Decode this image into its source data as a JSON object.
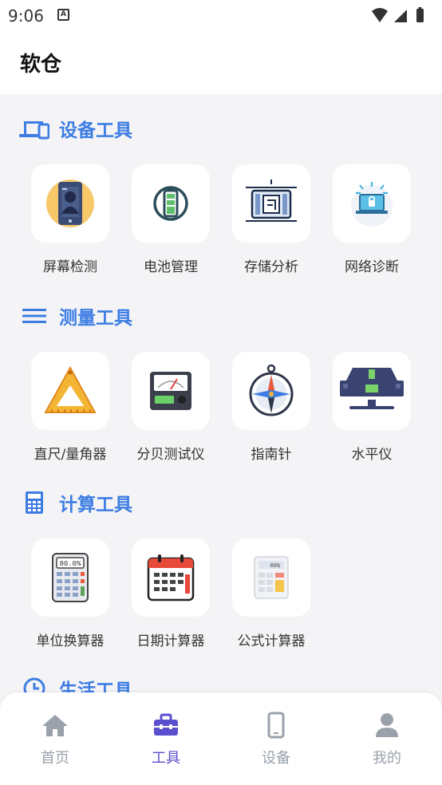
{
  "status": {
    "time": "9:06",
    "notif_glyph": "A"
  },
  "app": {
    "title": "软仓"
  },
  "accent_color": "#3d7de3",
  "sections": [
    {
      "title": "设备工具",
      "icon": "devices-icon",
      "tools": [
        {
          "label": "屏幕检测",
          "icon": "phone-screen-icon"
        },
        {
          "label": "电池管理",
          "icon": "battery-icon"
        },
        {
          "label": "存储分析",
          "icon": "storage-chip-icon"
        },
        {
          "label": "网络诊断",
          "icon": "network-laptop-icon"
        }
      ]
    },
    {
      "title": "测量工具",
      "icon": "list-lines-icon",
      "tools": [
        {
          "label": "直尺/量角器",
          "icon": "ruler-triangle-icon"
        },
        {
          "label": "分贝测试仪",
          "icon": "decibel-meter-icon"
        },
        {
          "label": "指南针",
          "icon": "compass-icon"
        },
        {
          "label": "水平仪",
          "icon": "spirit-level-icon"
        }
      ]
    },
    {
      "title": "计算工具",
      "icon": "calculator-icon",
      "tools": [
        {
          "label": "单位换算器",
          "icon": "unit-calculator-icon",
          "display": "80.0%"
        },
        {
          "label": "日期计算器",
          "icon": "calendar-icon"
        },
        {
          "label": "公式计算器",
          "icon": "formula-calculator-icon",
          "display": "80%"
        }
      ]
    },
    {
      "title": "生活工具",
      "icon": "clock-icon",
      "tools": []
    }
  ],
  "tabs": [
    {
      "label": "首页",
      "icon": "home-icon",
      "active": false
    },
    {
      "label": "工具",
      "icon": "toolbox-icon",
      "active": true
    },
    {
      "label": "设备",
      "icon": "phone-icon",
      "active": false
    },
    {
      "label": "我的",
      "icon": "user-icon",
      "active": false
    }
  ],
  "tab_active_color": "#5a4fcf",
  "tab_inactive_color": "#9aa1ab"
}
